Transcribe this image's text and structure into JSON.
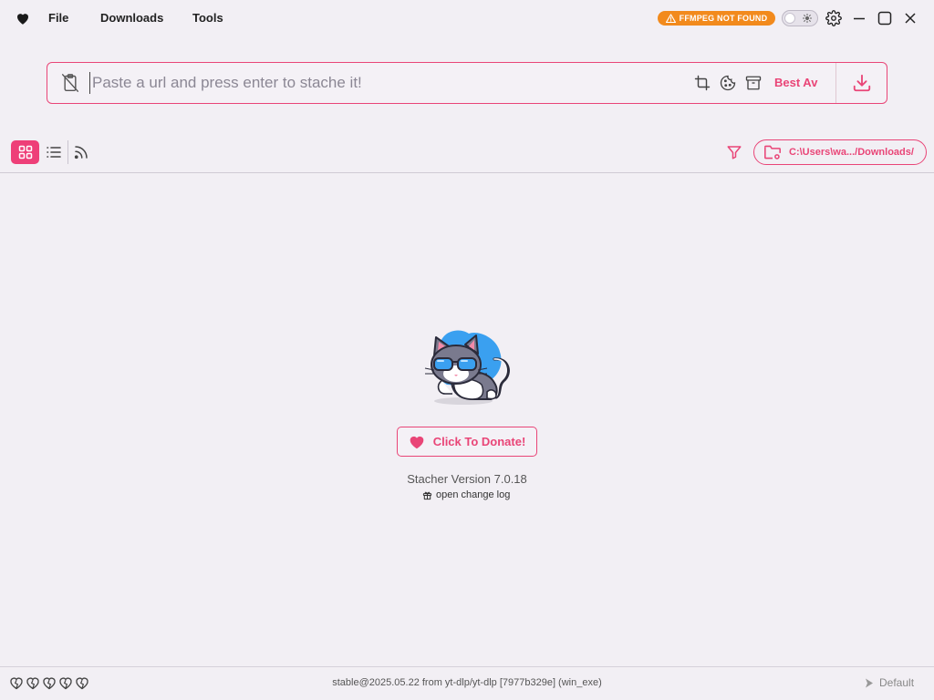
{
  "menu": {
    "file": "File",
    "downloads": "Downloads",
    "tools": "Tools"
  },
  "warning_badge": "FFMPEG NOT FOUND",
  "url_bar": {
    "placeholder": "Paste a url and press enter to stache it!",
    "value": "",
    "quality": "Best Av"
  },
  "download_folder": "C:\\Users\\wa.../Downloads/",
  "donate_label": "Click To Donate!",
  "version": "Stacher Version 7.0.18",
  "changelog_label": "open change log",
  "footer": {
    "status": "stable@2025.05.22 from yt-dlp/yt-dlp [7977b329e] (win_exe)",
    "profile": "Default",
    "heart_count": 5
  },
  "colors": {
    "accent": "#e94577",
    "warning": "#f28a1c",
    "background": "#f2eff4"
  },
  "icons": [
    "heart-icon",
    "warning-icon",
    "sun-icon",
    "gear-icon",
    "minimize-icon",
    "maximize-icon",
    "close-icon",
    "clipboard-off-icon",
    "crop-icon",
    "cookie-icon",
    "archive-icon",
    "download-icon",
    "grid-view-icon",
    "list-view-icon",
    "rss-icon",
    "filter-icon",
    "folder-settings-icon",
    "gift-icon",
    "chevron-right-icon"
  ]
}
